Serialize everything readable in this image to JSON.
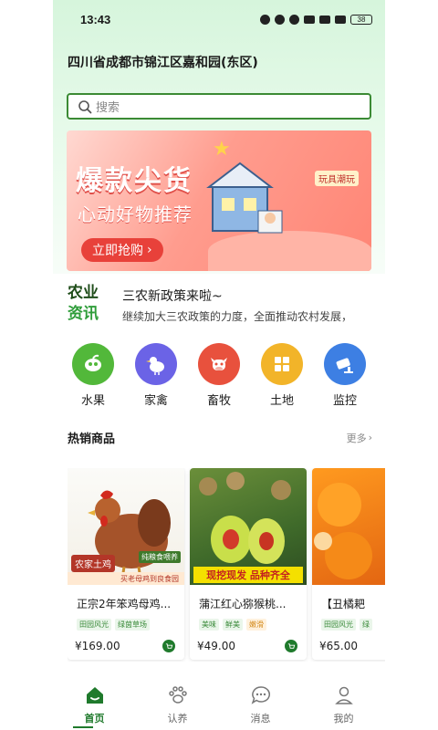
{
  "status_bar": {
    "time": "13:43",
    "battery": "38"
  },
  "location": {
    "address": "四川省成都市锦江区嘉和园(东区)"
  },
  "search": {
    "placeholder": "搜索"
  },
  "banner": {
    "headline": "爆款尖货",
    "subline": "心动好物推荐",
    "cta": "立即抢购",
    "tag": "玩具潮玩"
  },
  "news": {
    "logo_line1": "农业",
    "logo_line2": "资讯",
    "title": "三农新政策来啦~",
    "body": "继续加大三农政策的力度，全面推动农村发展，"
  },
  "categories": [
    {
      "label": "水果",
      "color": "#52b83a",
      "icon": "fruit-icon"
    },
    {
      "label": "家禽",
      "color": "#6b63e6",
      "icon": "poultry-icon"
    },
    {
      "label": "畜牧",
      "color": "#e8513d",
      "icon": "livestock-icon"
    },
    {
      "label": "土地",
      "color": "#f2b429",
      "icon": "land-icon"
    },
    {
      "label": "监控",
      "color": "#3d7fe3",
      "icon": "camera-icon"
    }
  ],
  "hot_section": {
    "title": "热销商品",
    "more": "更多"
  },
  "products": [
    {
      "name": "正宗2年笨鸡母鸡...",
      "tags": [
        "田园风光",
        "绿茵草场"
      ],
      "price": "¥169.00",
      "overlay_tag": "农家土鸡",
      "overlay_small": "纯粮食喂养",
      "overlay_band": "买老母鸡到良食园"
    },
    {
      "name": "蒲江红心猕猴桃...",
      "tags": [
        "美味",
        "鲜美",
        "嫩滑"
      ],
      "price": "¥49.00",
      "overlay_banner": "现挖现发 品种齐全"
    },
    {
      "name": "【丑橘耙",
      "tags": [
        "田园风光",
        "绿"
      ],
      "price": "¥65.00"
    }
  ],
  "tabs": [
    {
      "label": "首页",
      "icon": "home-icon",
      "active": true
    },
    {
      "label": "认养",
      "icon": "paw-icon",
      "active": false
    },
    {
      "label": "消息",
      "icon": "chat-icon",
      "active": false
    },
    {
      "label": "我的",
      "icon": "user-icon",
      "active": false
    }
  ],
  "colors": {
    "brand_green": "#1f7a2c",
    "search_border": "#3b8a34",
    "banner_red": "#e8413a"
  }
}
